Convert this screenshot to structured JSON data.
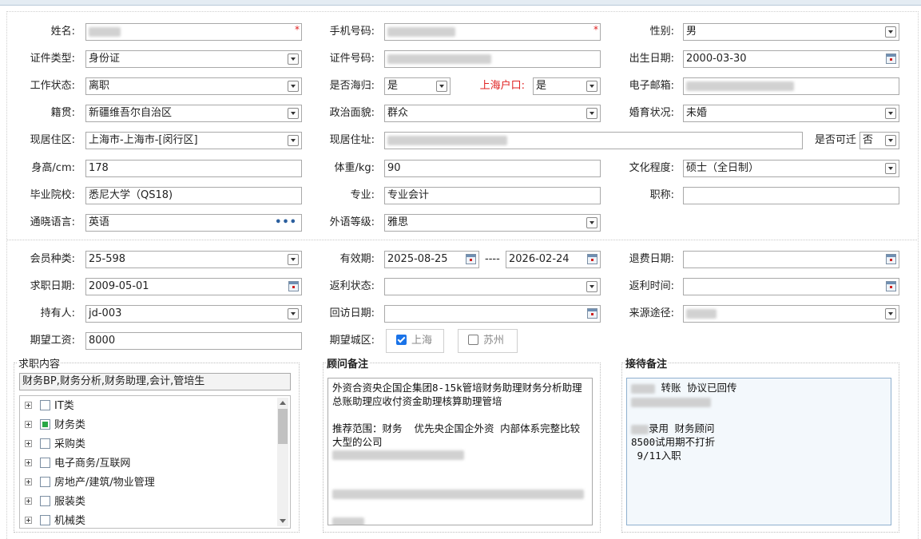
{
  "req_mark": "*",
  "form": {
    "name_label": "姓名:",
    "phone_label": "手机号码:",
    "gender_label": "性别:",
    "gender_value": "男",
    "id_type_label": "证件类型:",
    "id_type_value": "身份证",
    "id_no_label": "证件号码:",
    "birth_label": "出生日期:",
    "birth_value": "2000-03-30",
    "work_status_label": "工作状态:",
    "work_status_value": "离职",
    "returnee_label": "是否海归:",
    "returnee_value": "是",
    "sh_hukou_label": "上海户口:",
    "sh_hukou_value": "是",
    "email_label": "电子邮箱:",
    "native_label": "籍贯:",
    "native_value": "新疆维吾尔自治区",
    "politics_label": "政治面貌:",
    "politics_value": "群众",
    "marital_label": "婚育状况:",
    "marital_value": "未婚",
    "area_label": "现居住区:",
    "area_value": "上海市-上海市-[闵行区]",
    "address_label": "现居住址:",
    "relocate_label": "是否可迁",
    "relocate_value": "否",
    "height_label": "身高/cm:",
    "height_value": "178",
    "weight_label": "体重/kg:",
    "weight_value": "90",
    "education_label": "文化程度:",
    "education_value": "硕士（全日制）",
    "school_label": "毕业院校:",
    "school_value": "悉尼大学（QS18)",
    "major_label": "专业:",
    "major_value": "专业会计",
    "title_label": "职称:",
    "language_label": "通晓语言:",
    "language_value": "英语",
    "lang_level_label": "外语等级:",
    "lang_level_value": "雅思",
    "member_type_label": "会员种类:",
    "member_type_value": "25-598",
    "valid_label": "有效期:",
    "valid_from": "2025-08-25",
    "valid_sep": "----",
    "valid_to": "2026-02-24",
    "refund_date_label": "退费日期:",
    "job_date_label": "求职日期:",
    "job_date_value": "2009-05-01",
    "rebate_status_label": "返利状态:",
    "rebate_time_label": "返利时间:",
    "holder_label": "持有人:",
    "holder_value": "jd-003",
    "visit_date_label": "回访日期:",
    "source_label": "来源途径:",
    "salary_label": "期望工资:",
    "salary_value": "8000",
    "city_label": "期望城区:",
    "city_options": [
      {
        "label": "上海",
        "checked": true
      },
      {
        "label": "苏州",
        "checked": false
      }
    ]
  },
  "job_panel": {
    "title": "求职内容",
    "summary": "财务BP,财务分析,财务助理,会计,管培生",
    "tree": [
      {
        "label": "IT类",
        "state": "none"
      },
      {
        "label": "财务类",
        "state": "partial"
      },
      {
        "label": "采购类",
        "state": "none"
      },
      {
        "label": "电子商务/互联网",
        "state": "none"
      },
      {
        "label": "房地产/建筑/物业管理",
        "state": "none"
      },
      {
        "label": "服装类",
        "state": "none"
      },
      {
        "label": "机械类",
        "state": "none"
      }
    ]
  },
  "advisor_panel": {
    "title": "顾问备注",
    "text": "外资合资央企国企集团8-15k管培财务助理财务分析助理总账助理应收付资金助理核算助理管培\n\n推荐范围：财务  优先央企国企外资 内部体系完整比较大型的公司"
  },
  "reception_panel": {
    "title": "接待备注",
    "line1": " 转账 协议已回传",
    "line2": "录用 财务顾问",
    "line3": "8500试用期不打折",
    "line4": " 9/11入职"
  }
}
